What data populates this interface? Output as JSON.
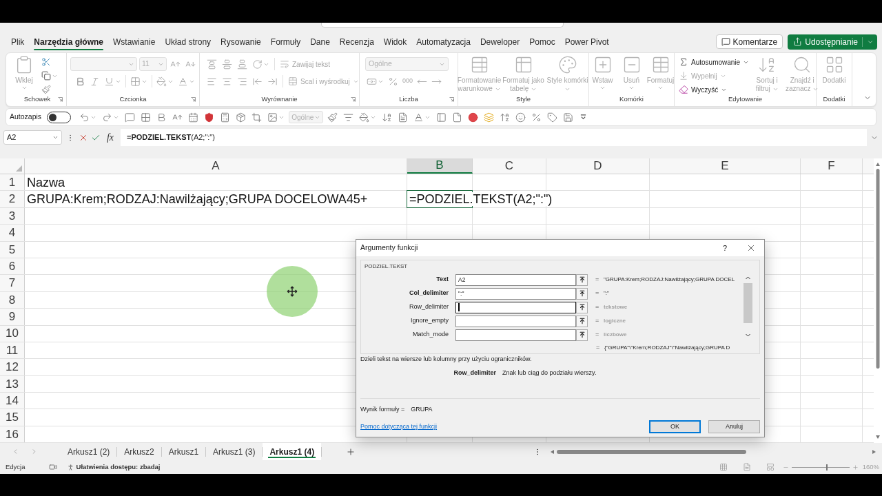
{
  "ribbon_tabs": [
    {
      "label": "Plik",
      "selected": false
    },
    {
      "label": "Narzędzia główne",
      "selected": true
    },
    {
      "label": "Wstawianie",
      "selected": false
    },
    {
      "label": "Układ strony",
      "selected": false
    },
    {
      "label": "Rysowanie",
      "selected": false
    },
    {
      "label": "Formuły",
      "selected": false
    },
    {
      "label": "Dane",
      "selected": false
    },
    {
      "label": "Recenzja",
      "selected": false
    },
    {
      "label": "Widok",
      "selected": false
    },
    {
      "label": "Automatyzacja",
      "selected": false
    },
    {
      "label": "Deweloper",
      "selected": false
    },
    {
      "label": "Pomoc",
      "selected": false
    },
    {
      "label": "Power Pivot",
      "selected": false
    }
  ],
  "header_buttons": {
    "comments": "Komentarze",
    "share": "Udostępnianie"
  },
  "ribbon": {
    "clipboard": {
      "title": "Schowek",
      "paste": {
        "label": "Wklej",
        "disabled": true
      }
    },
    "font": {
      "title": "Czcionka",
      "size": "11"
    },
    "alignment": {
      "title": "Wyrównanie",
      "wrap_text": {
        "label": "Zawijaj tekst",
        "disabled": true
      },
      "merge": {
        "label": "Scal i wyśrodkuj",
        "disabled": true
      }
    },
    "number": {
      "title": "Liczba",
      "format": "Ogólne",
      "thousands": "000"
    },
    "styles": {
      "title": "Style",
      "buttons": [
        {
          "label": "Formatowanie warunkowe",
          "disabled": true
        },
        {
          "label": "Formatuj jako tabelę",
          "disabled": true
        },
        {
          "label": "Style komórki",
          "disabled": true
        }
      ]
    },
    "cells": {
      "title": "Komórki",
      "buttons": [
        {
          "label": "Wstaw",
          "disabled": true
        },
        {
          "label": "Usuń",
          "disabled": true
        },
        {
          "label": "Formatuj",
          "disabled": true
        }
      ]
    },
    "editing": {
      "title": "Edytowanie",
      "autosum": {
        "label": "Autosumowanie",
        "disabled": false
      },
      "fill": {
        "label": "Wypełnij",
        "disabled": true
      },
      "clear": {
        "label": "Wyczyść",
        "disabled": false
      },
      "sort": {
        "label": "Sortuj i filtruj",
        "disabled": true
      },
      "find": {
        "label": "Znajdź i zaznacz",
        "disabled": true
      }
    },
    "addins": {
      "title": "Dodatki",
      "button": {
        "label": "Dodatki",
        "disabled": true
      }
    }
  },
  "quick_access": {
    "autosave_label": "Autozapis",
    "autosave_on": false,
    "number_format": "Ogólne"
  },
  "formula_bar": {
    "name_box": "A2",
    "function_button": "fx",
    "formula": "**=PODZIEL.TEKST**(A2;\":\")"
  },
  "sheet": {
    "columns": [
      {
        "label": "A",
        "selected": false
      },
      {
        "label": "B",
        "selected": true
      },
      {
        "label": "C",
        "selected": false
      },
      {
        "label": "D",
        "selected": false
      },
      {
        "label": "E",
        "selected": false
      },
      {
        "label": "F",
        "selected": false
      }
    ],
    "rows": [
      {
        "label": "1",
        "cells": [
          {
            "text": "Nazwa",
            "active": false
          }
        ]
      },
      {
        "label": "2",
        "cells": [
          {
            "text": "GRUPA:Krem;RODZAJ:Nawilżający;GRUPA DOCELOWA45+",
            "active": false
          },
          {
            "text": "=PODZIEL.TEKST(A2;\":\")",
            "active": true
          }
        ]
      },
      {
        "label": "3"
      },
      {
        "label": "4"
      },
      {
        "label": "5"
      },
      {
        "label": "6"
      },
      {
        "label": "7"
      },
      {
        "label": "8"
      },
      {
        "label": "9"
      },
      {
        "label": "10"
      },
      {
        "label": "11"
      },
      {
        "label": "12"
      },
      {
        "label": "13"
      },
      {
        "label": "14"
      },
      {
        "label": "15"
      },
      {
        "label": "16"
      }
    ]
  },
  "dialog": {
    "title": "Argumenty funkcji",
    "help": "?",
    "function_name": "PODZIEL.TEKST",
    "arguments": [
      {
        "kind": "value",
        "name": "Text",
        "required": true,
        "value": "A2",
        "focused": false,
        "equals": "=",
        "result": "\"GRUPA:Krem;RODZAJ:Nawilżający;GRUPA DOCEL"
      },
      {
        "kind": "value",
        "name": "Col_delimiter",
        "required": true,
        "value": "\":\"",
        "focused": false,
        "equals": "=",
        "result": "\":\""
      },
      {
        "kind": "type",
        "name": "Row_delimiter",
        "required": false,
        "focused": true,
        "equals": "=",
        "result": "tekstowe"
      },
      {
        "kind": "type",
        "name": "Ignore_empty",
        "required": false,
        "focused": false,
        "equals": "=",
        "result": "logiczne"
      },
      {
        "kind": "type",
        "name": "Match_mode",
        "required": false,
        "focused": false,
        "equals": "=",
        "result": "liczbowe"
      }
    ],
    "preview_equals": "=",
    "preview": "{\"GRUPA\"\\\"Krem;RODZAJ\"\\\"Nawilżający;GRUPA D",
    "description": "Dzieli tekst na wiersze lub kolumny przy użyciu ograniczników.",
    "argument_help": {
      "name": "Row_delimiter",
      "text": "Znak lub ciąg do podziału wierszy."
    },
    "formula_result_label": "Wynik formuły =",
    "formula_result": "GRUPA",
    "help_link": "Pomoc dotycząca tej funkcji",
    "buttons": [
      {
        "label": "OK",
        "default": true
      },
      {
        "label": "Anuluj",
        "default": false
      }
    ]
  },
  "sheet_tabs": [
    {
      "label": "Arkusz1 (2)",
      "selected": false
    },
    {
      "label": "Arkusz2",
      "selected": false
    },
    {
      "label": "Arkusz1",
      "selected": false
    },
    {
      "label": "Arkusz1 (3)",
      "selected": false
    },
    {
      "label": "Arkusz1 (4)",
      "selected": true
    }
  ],
  "status_bar": {
    "mode": "Edycja",
    "accessibility": "Ułatwienia dostępu: zbadaj",
    "zoom": {
      "level": 0.6,
      "reading": "160%"
    }
  }
}
